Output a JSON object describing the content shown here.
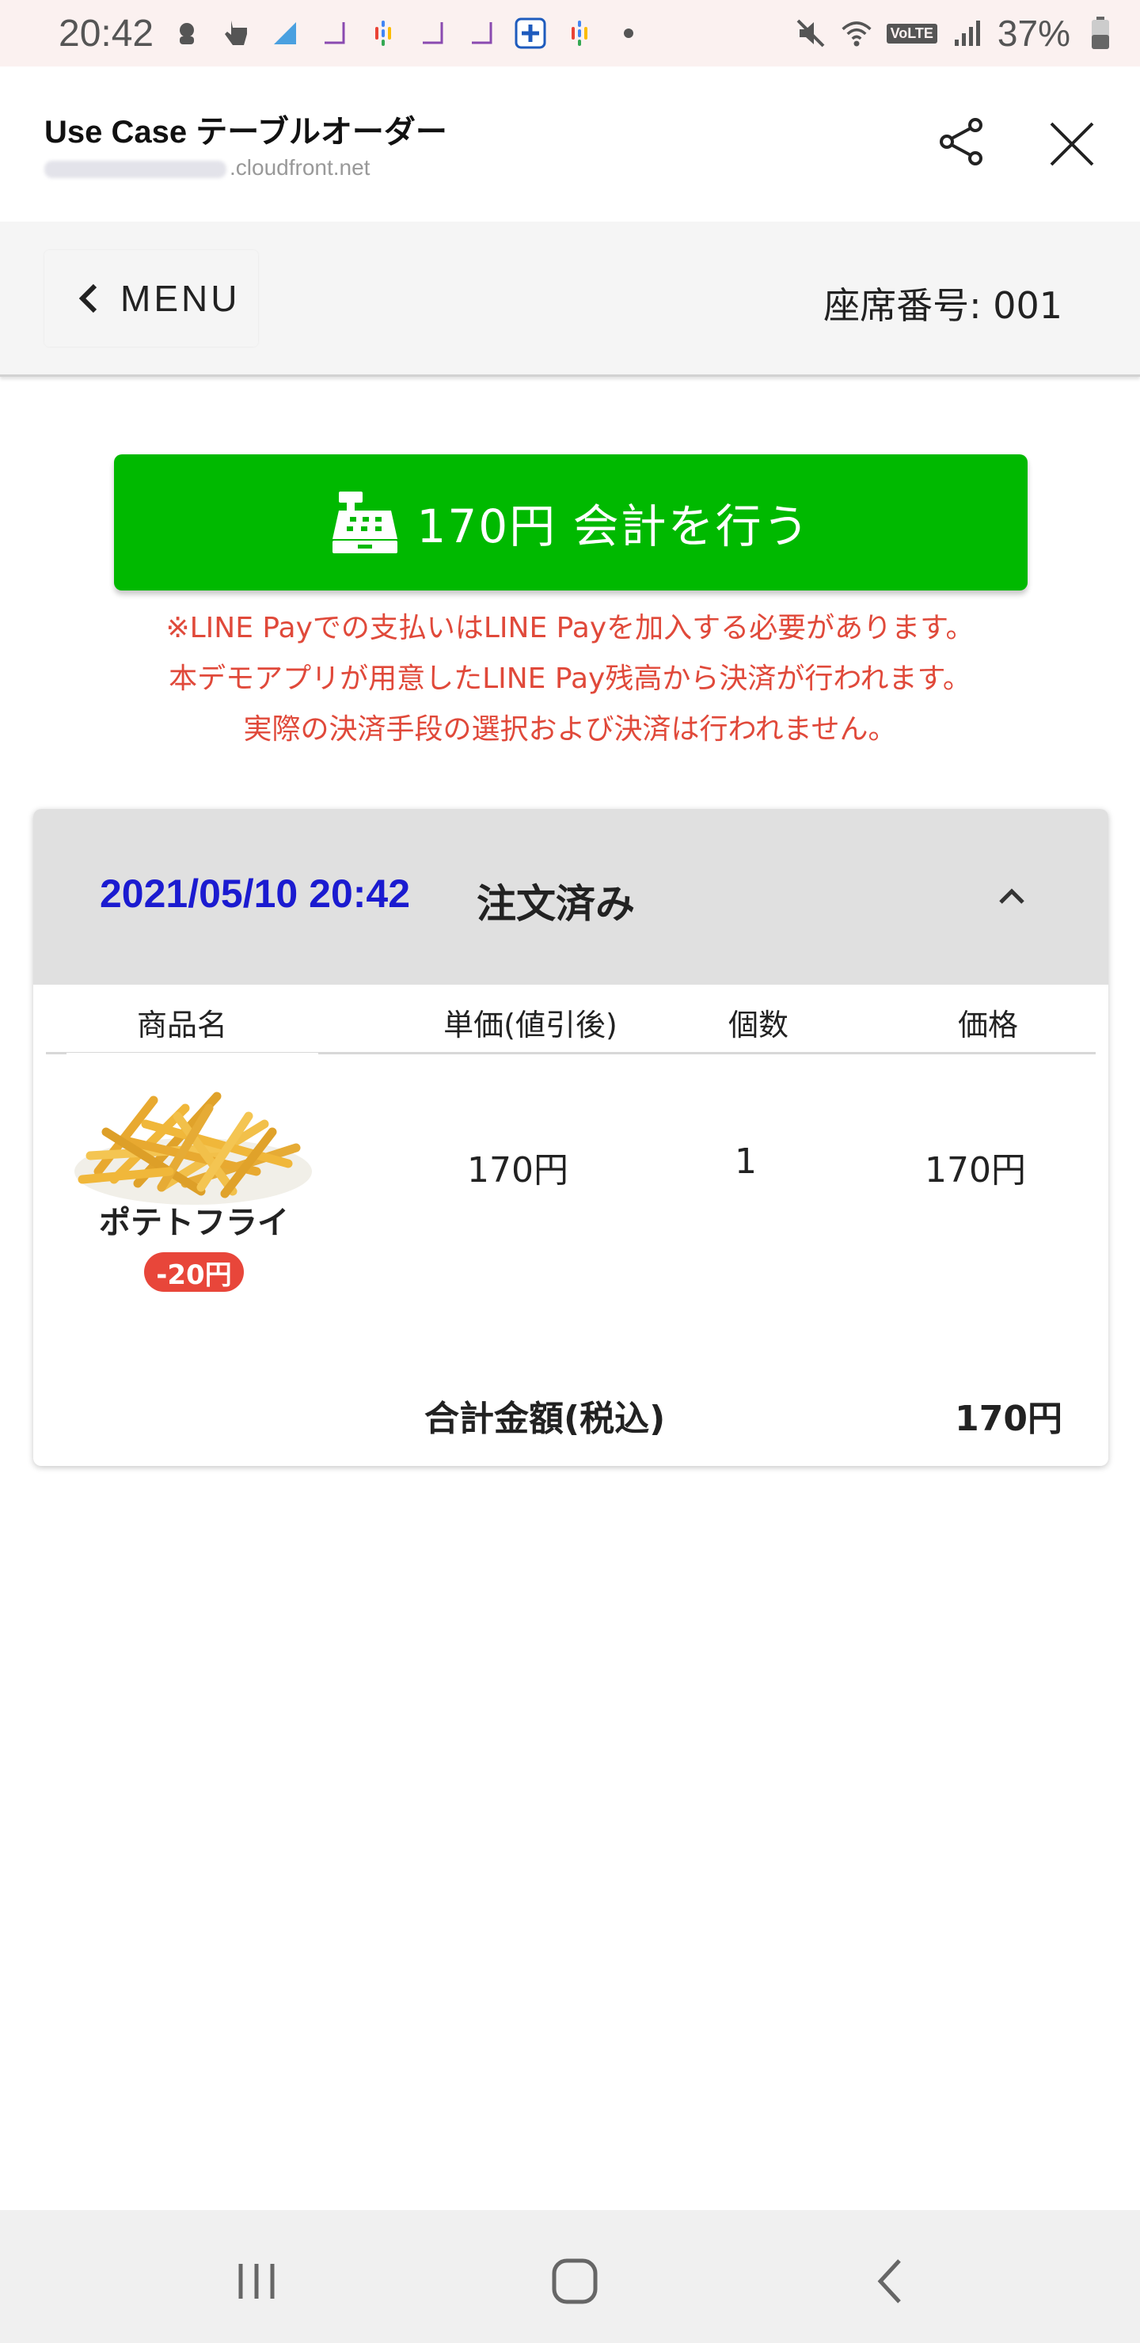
{
  "status_bar": {
    "time": "20:42",
    "battery": "37%",
    "network_badge": "VoLTE",
    "icons": [
      "coin-master-icon",
      "pointer-icon",
      "sheets-icon",
      "ticket-icon",
      "google-podcasts-icon",
      "ticket-icon",
      "ticket-icon",
      "plus-app-icon",
      "google-podcasts-icon",
      "dot-icon",
      "mute-icon",
      "wifi-icon",
      "signal-icon",
      "battery-icon"
    ]
  },
  "browser": {
    "title": "Use Case テーブルオーダー",
    "url_visible": ".cloudfront.net"
  },
  "page_header": {
    "menu_label": "MENU",
    "seat_label": "座席番号: 001"
  },
  "pay_button": {
    "label": "170円 会計を行う",
    "icon": "cash-register-icon",
    "color": "#00b900"
  },
  "notes": [
    "※LINE Payでの支払いはLINE Payを加入する必要があります。",
    "本デモアプリが用意したLINE Pay残高から決済が行われます。",
    "実際の決済手段の選択および決済は行われません。"
  ],
  "order": {
    "datetime": "2021/05/10 20:42",
    "status": "注文済み",
    "columns": [
      "商品名",
      "単価(値引後)",
      "個数",
      "価格"
    ],
    "items": [
      {
        "name": "ポテトフライ",
        "discount": "-20円",
        "unit_price": "170円",
        "qty": "1",
        "price": "170円"
      }
    ],
    "total_label": "合計金額(税込)",
    "total": "170円"
  },
  "colors": {
    "accent_green": "#00b900",
    "note_red": "#e0493a",
    "date_blue": "#1b1bd0",
    "badge_red": "#e8463a"
  }
}
